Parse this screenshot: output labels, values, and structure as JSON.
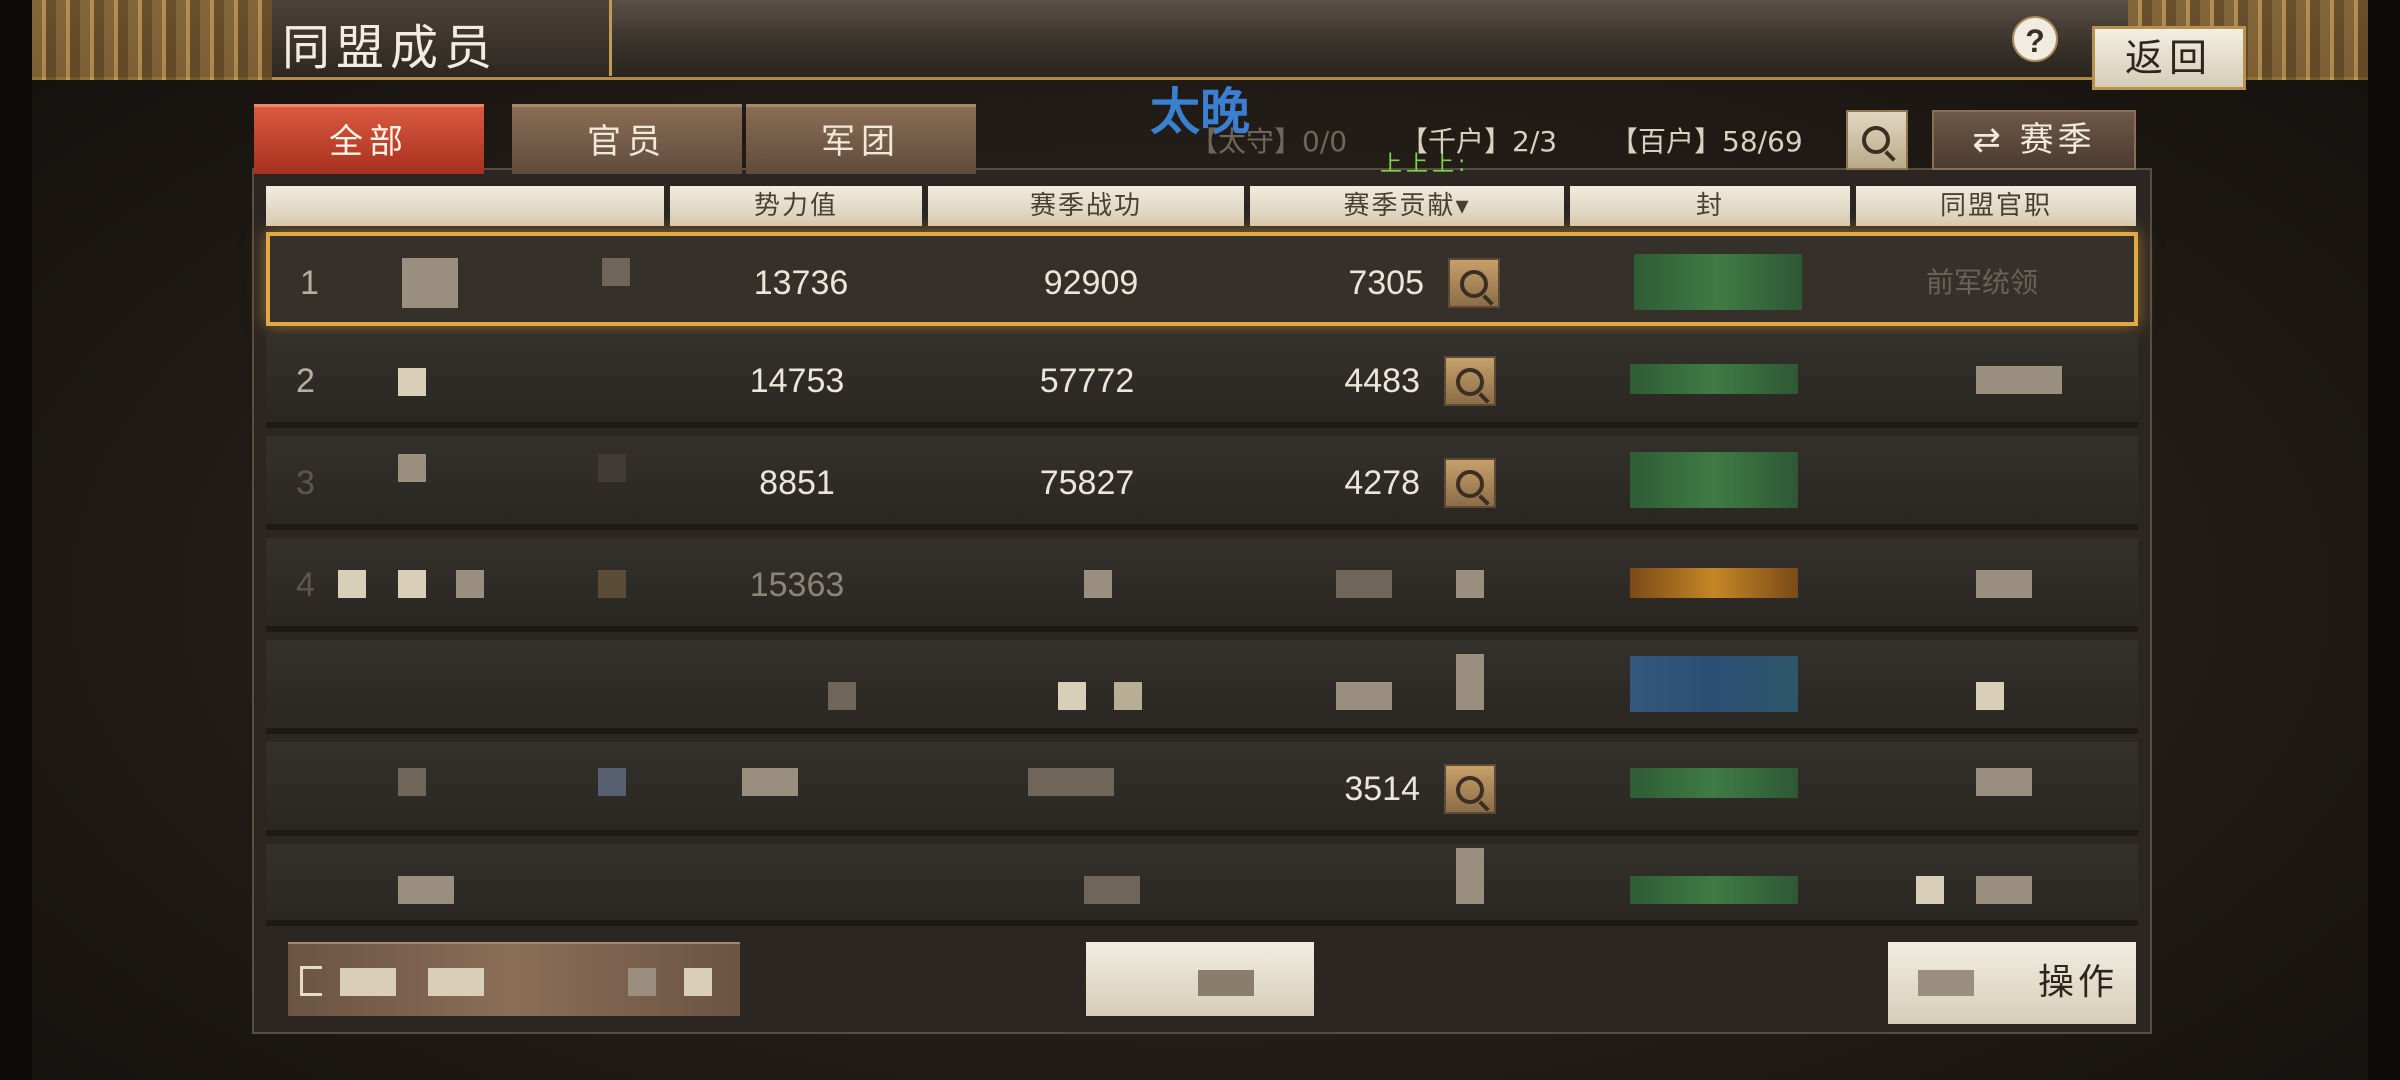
{
  "header": {
    "title": "同盟成员",
    "help": "?",
    "back": "返回"
  },
  "tabs": [
    {
      "label": "全部",
      "active": true
    },
    {
      "label": "官员",
      "active": false
    },
    {
      "label": "军团",
      "active": false
    }
  ],
  "overlay": {
    "name": "太晚",
    "sub": "上上上:"
  },
  "stats": {
    "taishou": "【太守】0/0",
    "qianhu": "【千户】2/3",
    "baihu": "【百户】58/69"
  },
  "season_button": "赛季",
  "columns": [
    "",
    "势力值",
    "赛季战功",
    "赛季贡献▾",
    "封",
    "同盟官职"
  ],
  "rows": [
    {
      "rank": "1",
      "power": "13736",
      "merit": "92909",
      "contribution": "7305",
      "officer": "前军统领"
    },
    {
      "rank": "2",
      "power": "14753",
      "merit": "57772",
      "contribution": "4483",
      "officer": ""
    },
    {
      "rank": "3",
      "power": "8851",
      "merit": "75827",
      "contribution": "4278",
      "officer": ""
    },
    {
      "rank": "4",
      "power": "15363",
      "merit": "",
      "contribution": "",
      "officer": ""
    },
    {
      "rank": "",
      "power": "",
      "merit": "",
      "contribution": "",
      "officer": ""
    },
    {
      "rank": "",
      "power": "",
      "merit": "",
      "contribution": "3514",
      "officer": ""
    },
    {
      "rank": "",
      "power": "",
      "merit": "",
      "contribution": "",
      "officer": ""
    }
  ],
  "footer": {
    "operate": "操作"
  },
  "colors": {
    "accent_gold": "#e1a844",
    "tab_active": "#c0402b",
    "name_blue": "#3a7fd0"
  },
  "icons": [
    "help-icon",
    "search-icon",
    "season-switch-icon",
    "exit-icon"
  ]
}
